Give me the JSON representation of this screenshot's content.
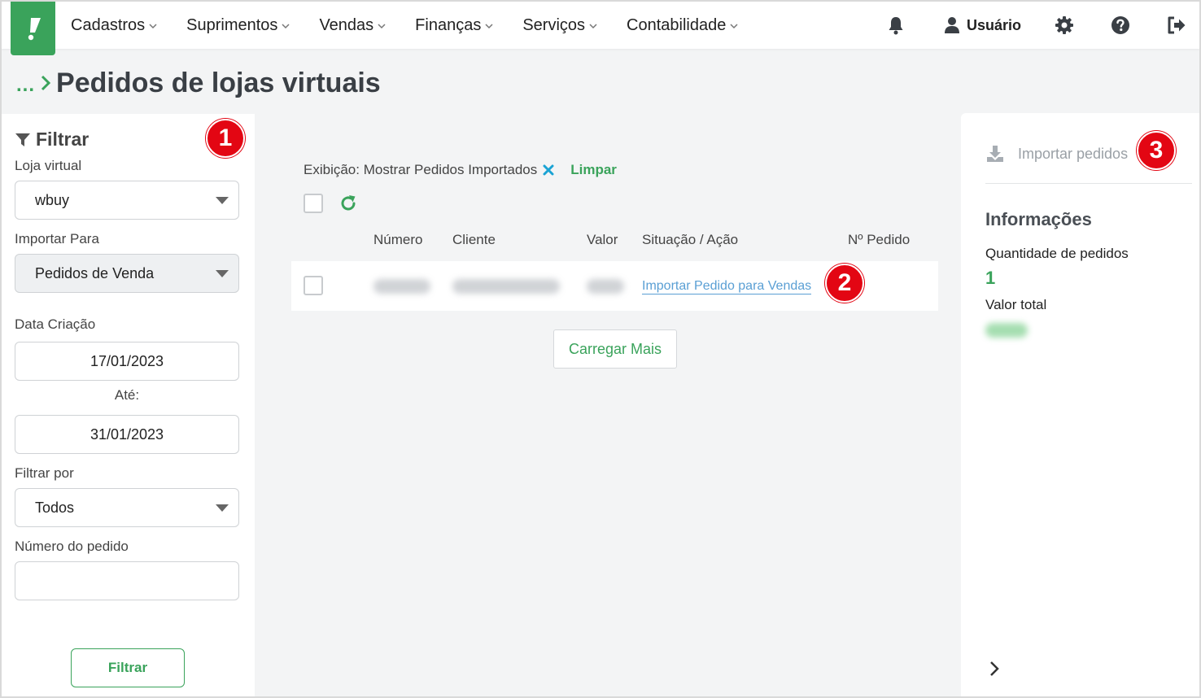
{
  "nav": {
    "items": [
      "Cadastros",
      "Suprimentos",
      "Vendas",
      "Finanças",
      "Serviços",
      "Contabilidade"
    ],
    "user_label": "Usuário"
  },
  "breadcrumb": {
    "ellipsis": "...",
    "title": "Pedidos de lojas virtuais"
  },
  "filter": {
    "heading": "Filtrar",
    "loja_label": "Loja virtual",
    "loja_value": "wbuy",
    "importar_label": "Importar Para",
    "importar_value": "Pedidos de Venda",
    "data_label": "Data Criação",
    "date_from": "17/01/2023",
    "ate_label": "Até:",
    "date_to": "31/01/2023",
    "filtrar_por_label": "Filtrar por",
    "filtrar_por_value": "Todos",
    "numero_label": "Número do pedido",
    "numero_value": "",
    "button": "Filtrar"
  },
  "display": {
    "text": "Exibição: Mostrar Pedidos Importados",
    "clear": "Limpar"
  },
  "table": {
    "columns": [
      "Número",
      "Cliente",
      "Valor",
      "Situação / Ação",
      "Nº Pedido"
    ],
    "rows": [
      {
        "action": "Importar Pedido para Vendas"
      }
    ]
  },
  "load_more": "Carregar Mais",
  "right_panel": {
    "import_label": "Importar pedidos",
    "info_title": "Informações",
    "qty_label": "Quantidade de pedidos",
    "qty_value": "1",
    "total_label": "Valor total"
  },
  "markers": [
    "1",
    "2",
    "3"
  ],
  "colors": {
    "brand_green": "#3aa35b",
    "marker_red": "#e30613",
    "link_blue": "#5a9fd4"
  }
}
